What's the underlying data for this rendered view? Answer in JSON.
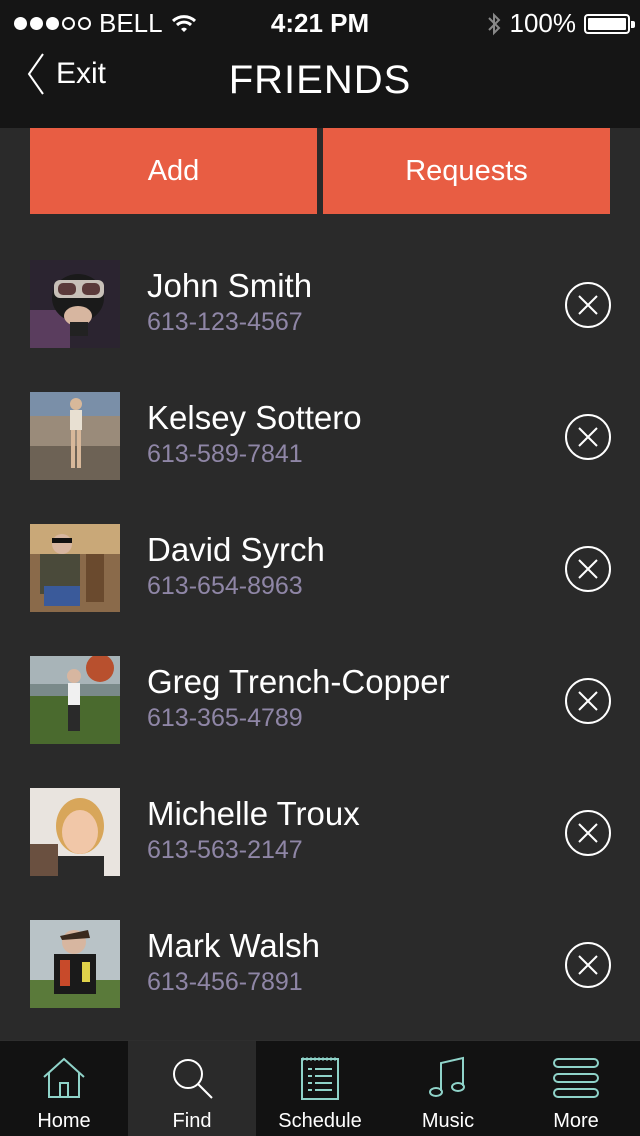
{
  "status": {
    "carrier": "BELL",
    "time": "4:21 PM",
    "battery": "100%"
  },
  "nav": {
    "back_label": "Exit",
    "title": "FRIENDS"
  },
  "actions": {
    "add_label": "Add",
    "requests_label": "Requests"
  },
  "friends": [
    {
      "name": "John Smith",
      "phone": "613-123-4567"
    },
    {
      "name": "Kelsey Sottero",
      "phone": "613-589-7841"
    },
    {
      "name": "David Syrch",
      "phone": "613-654-8963"
    },
    {
      "name": "Greg Trench-Copper",
      "phone": "613-365-4789"
    },
    {
      "name": "Michelle Troux",
      "phone": "613-563-2147"
    },
    {
      "name": "Mark Walsh",
      "phone": "613-456-7891"
    }
  ],
  "tabs": [
    {
      "label": "Home",
      "icon": "home-icon"
    },
    {
      "label": "Find",
      "icon": "search-icon"
    },
    {
      "label": "Schedule",
      "icon": "schedule-icon"
    },
    {
      "label": "Music",
      "icon": "music-icon"
    },
    {
      "label": "More",
      "icon": "more-icon"
    }
  ],
  "colors": {
    "accent": "#e85d43",
    "icon_teal": "#8fd3c9",
    "phone_text": "#8f86a6",
    "background": "#2a2a2a",
    "bar": "#151515"
  }
}
